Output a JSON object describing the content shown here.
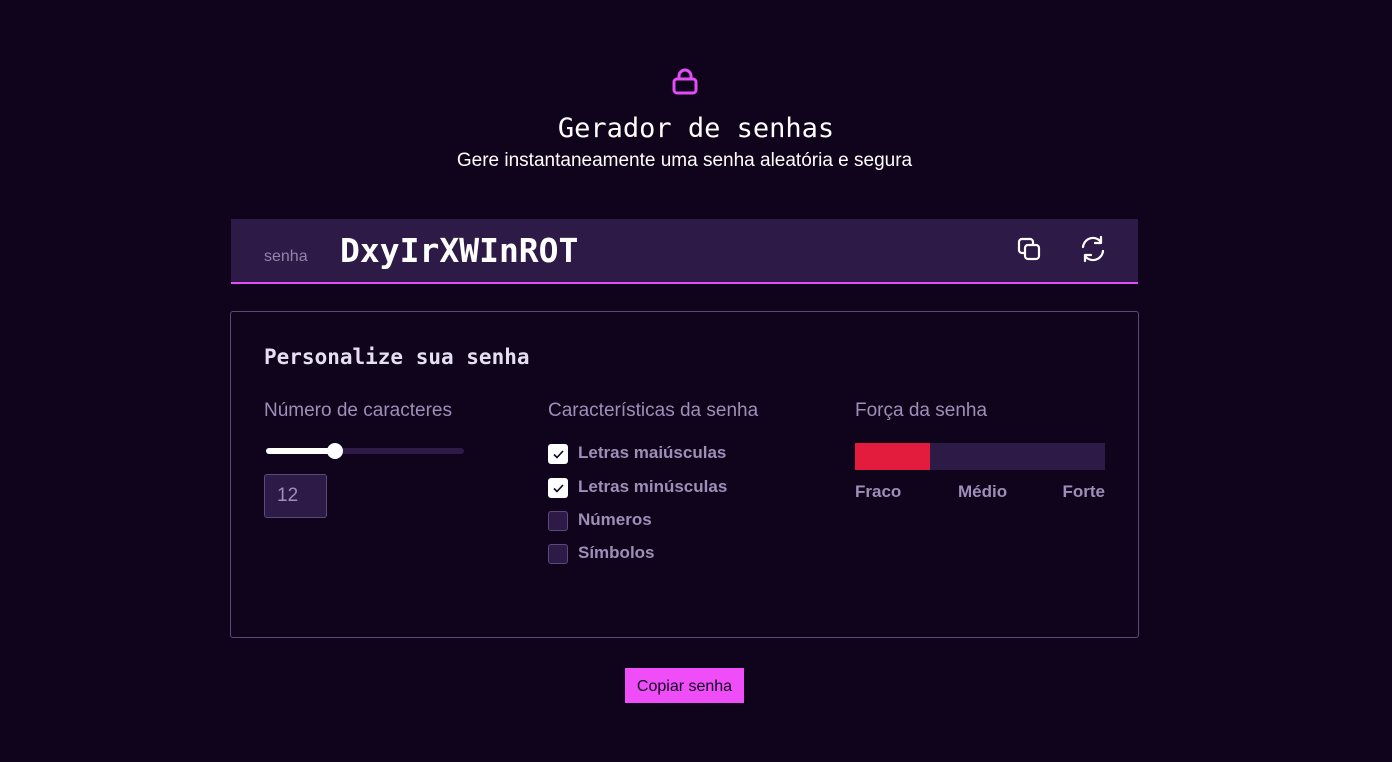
{
  "header": {
    "icon": "lock-icon",
    "title": "Gerador de senhas",
    "subtitle": "Gere instantaneamente uma senha aleatória e segura"
  },
  "password_bar": {
    "label": "senha",
    "value": "DxyIrXWInROT",
    "copy_icon": "copy-icon",
    "refresh_icon": "refresh-icon"
  },
  "customize": {
    "title": "Personalize sua senha",
    "length": {
      "heading": "Número de caracteres",
      "value": "12",
      "slider_fraction": 0.35
    },
    "features": {
      "heading": "Características da senha",
      "options": [
        {
          "label": "Letras maiúsculas",
          "checked": true
        },
        {
          "label": "Letras minúsculas",
          "checked": true
        },
        {
          "label": "Números",
          "checked": false
        },
        {
          "label": "Símbolos",
          "checked": false
        }
      ]
    },
    "strength": {
      "heading": "Força da senha",
      "level_fraction": 0.3,
      "level_color": "#e31c3d",
      "labels": [
        "Fraco",
        "Médio",
        "Forte"
      ]
    }
  },
  "actions": {
    "copy_button": "Copiar senha"
  },
  "colors": {
    "background": "#0f041b",
    "surface": "#2e1a47",
    "accent": "#ee4df7",
    "weak": "#e31c3d"
  }
}
